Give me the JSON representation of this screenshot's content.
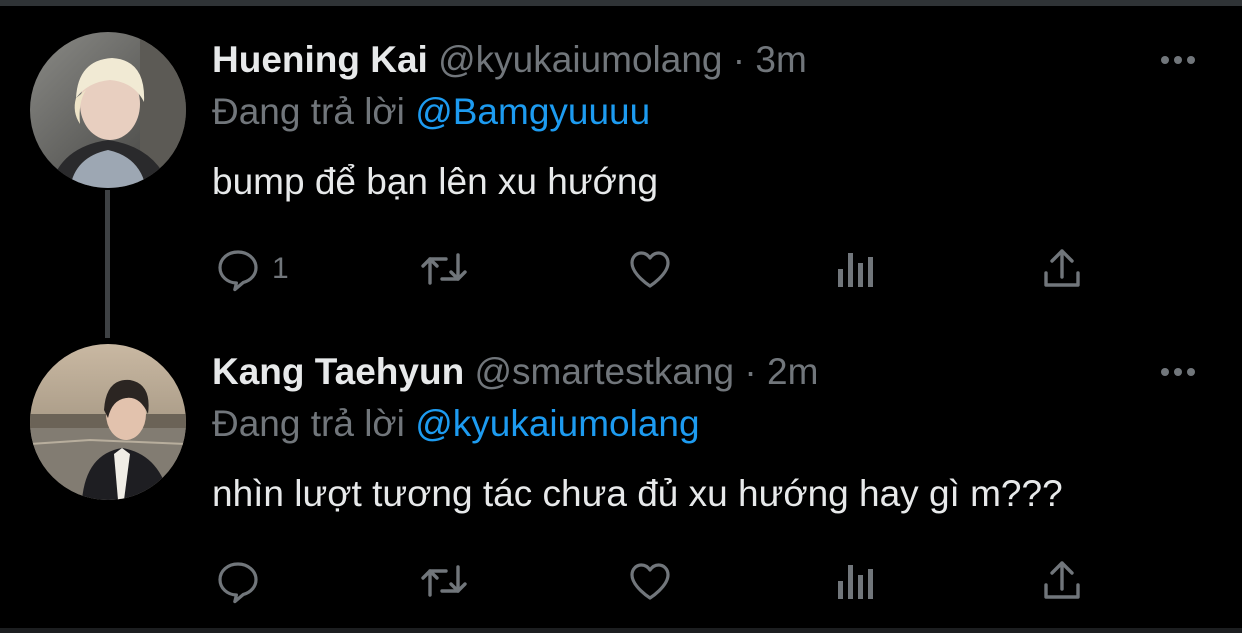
{
  "tweets": [
    {
      "name": "Huening Kai",
      "handle": "@kyukaiumolang",
      "separator": "·",
      "time": "3m",
      "reply_prefix": "Đang trả lời",
      "reply_to": "@Bamgyuuuu",
      "text": "bump để bạn lên xu hướng",
      "reply_count": "1",
      "actions": [
        "reply-icon",
        "retweet-icon",
        "like-icon",
        "analytics-icon",
        "share-icon"
      ]
    },
    {
      "name": "Kang Taehyun",
      "handle": "@smartestkang",
      "separator": "·",
      "time": "2m",
      "reply_prefix": "Đang trả lời",
      "reply_to": "@kyukaiumolang",
      "text": "nhìn lượt tương tác chưa đủ xu hướng hay gì m???",
      "reply_count": "",
      "actions": [
        "reply-icon",
        "retweet-icon",
        "like-icon",
        "analytics-icon",
        "share-icon"
      ]
    }
  ],
  "colors": {
    "background": "#000000",
    "primary_text": "#e7e9ea",
    "secondary_text": "#71767b",
    "link": "#1d9bf0",
    "thread_line": "#3e4144"
  }
}
